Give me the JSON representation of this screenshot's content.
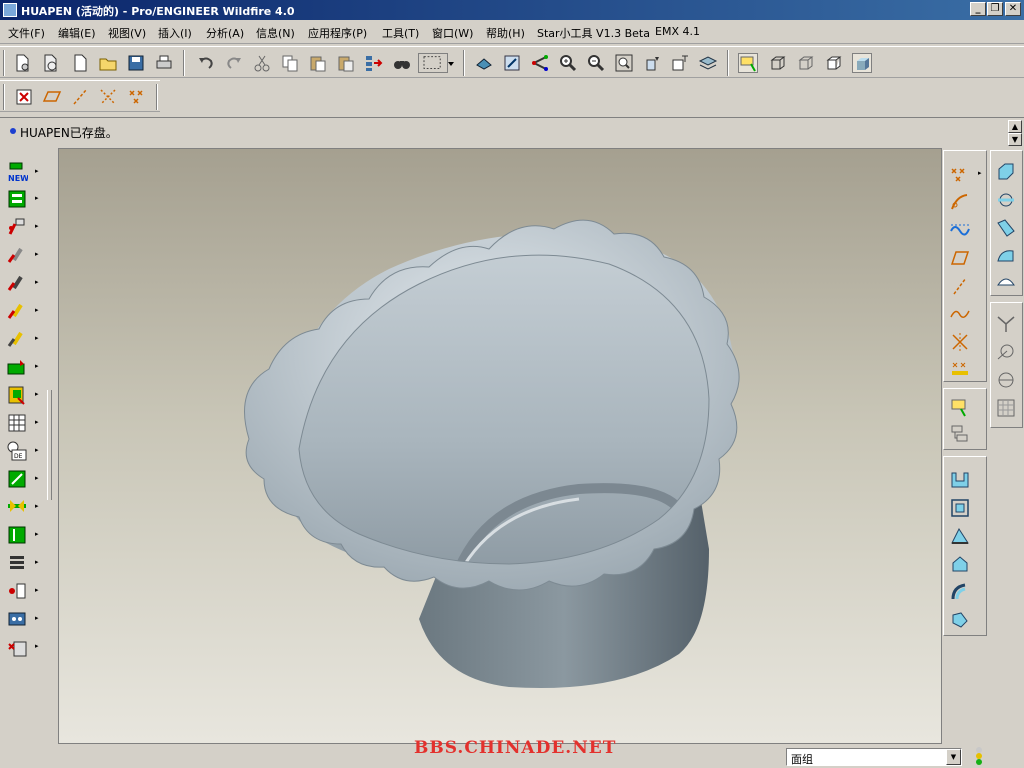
{
  "window": {
    "title": "HUAPEN (活动的) - Pro/ENGINEER Wildfire 4.0",
    "min_label": "_",
    "max_label": "❐",
    "close_label": "✕"
  },
  "menu": {
    "items": [
      {
        "label": "文件(F)"
      },
      {
        "label": "编辑(E)"
      },
      {
        "label": "视图(V)"
      },
      {
        "label": "插入(I)"
      },
      {
        "label": "分析(A)"
      },
      {
        "label": "信息(N)"
      },
      {
        "label": "应用程序(P)"
      },
      {
        "label": "工具(T)"
      },
      {
        "label": "窗口(W)"
      },
      {
        "label": "帮助(H)"
      },
      {
        "label": "Star小工具 V1.3 Beta"
      },
      {
        "label": "EMX 4.1"
      }
    ]
  },
  "message": {
    "text": "HUAPEN已存盘。"
  },
  "status": {
    "watermark": "BBS.CHINADE.NET",
    "filter_value": "面组",
    "dropdown_glyph": "▼"
  },
  "scroll": {
    "up": "▲",
    "down": "▼"
  },
  "left_toolbar": {
    "arrow_glyph": "▸",
    "new_label": "NEW",
    "de_label": "DE"
  },
  "colors": {
    "title_start": "#0a246a",
    "title_end": "#3a6ea5",
    "watermark": "#e3312d",
    "model": "#a8b4bd"
  },
  "icons": {
    "top_row1": [
      "new-file-icon",
      "open-file-icon",
      "save-icon",
      "print-icon",
      "undo-icon",
      "redo-icon",
      "cut-icon",
      "copy-icon",
      "paste-icon",
      "regenerate-icon",
      "find-icon",
      "select-box-icon",
      "spin-icon",
      "repaint-icon",
      "zoom-in-icon",
      "zoom-out-icon",
      "refit-icon",
      "named-view-icon",
      "layer-icon",
      "display-style-icon"
    ],
    "top_row2": [
      "close-window-icon",
      "datum-plane-display-icon",
      "datum-axis-display-icon",
      "datum-point-display-icon",
      "csys-display-icon"
    ]
  }
}
